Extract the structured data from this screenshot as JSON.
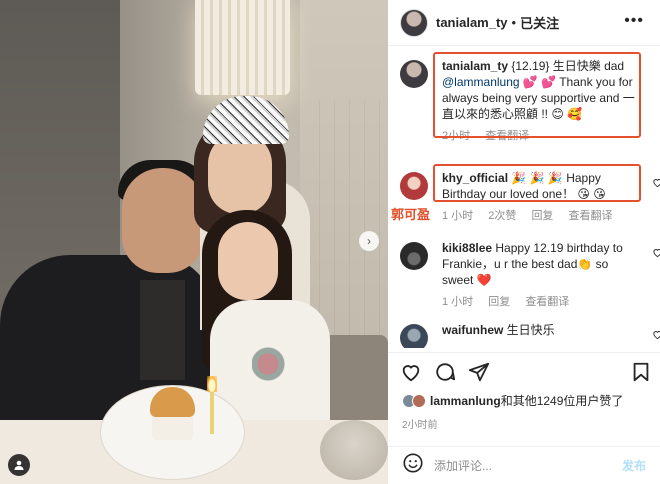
{
  "post_author": {
    "username": "tanialam_ty",
    "separator": "•",
    "follow_status": "已关注",
    "more_icon": "more-horizontal-icon"
  },
  "photo": {
    "description_icon": "photo",
    "overlay_label": "郭可盈",
    "next_icon": "chevron-right-icon",
    "tag_icon": "user-tag-icon"
  },
  "caption": {
    "username": "tanialam_ty",
    "text_before_mention": "{12.19} 生日快樂 dad ",
    "mention": "@lammanlung",
    "text_after_mention": " 💕 💕 Thank you for always being very supportive and 一直以來的悉心照顧 !! 😊 🥰",
    "time": "2小时",
    "translate": "查看翻译"
  },
  "comments": [
    {
      "username": "khy_official",
      "text": " 🎉 🎉 🎉 Happy Birthday our loved one！ 😘 😘",
      "time": "1 小时",
      "likes": "2次赞",
      "reply": "回复",
      "translate": "查看翻译"
    },
    {
      "username": "kiki88lee",
      "text": " Happy 12.19 birthday to Frankie，u r the best dad👏 so sweet ❤️",
      "time": "1 小时",
      "reply": "回复",
      "translate": "查看翻译"
    },
    {
      "username": "waifunhew",
      "text": " 生日快乐"
    }
  ],
  "actions": {
    "like_icon": "heart-icon",
    "comment_icon": "comment-icon",
    "share_icon": "send-icon",
    "save_icon": "bookmark-icon"
  },
  "likes": {
    "liker": "lammanlung",
    "rest": "和其他1249位用户赞了"
  },
  "post_time": "2小时前",
  "compose": {
    "emoji_icon": "smiley-icon",
    "placeholder": "添加评论...",
    "post_label": "发布"
  },
  "colors": {
    "highlight": "#e5502f",
    "link": "#00376b",
    "muted": "#8e8e8e",
    "post_disabled": "#b2dffc"
  }
}
